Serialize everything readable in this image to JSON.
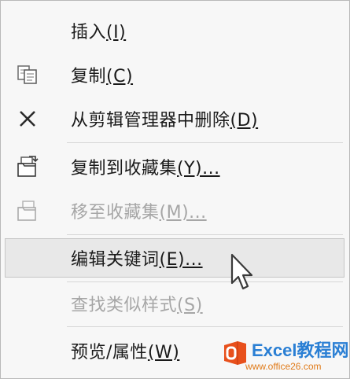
{
  "menu": {
    "items": [
      {
        "text": "插入",
        "accel": "(I)",
        "disabled": false,
        "icon": "none"
      },
      {
        "text": "复制",
        "accel": "(C)",
        "disabled": false,
        "icon": "copy-icon"
      },
      {
        "text": "从剪辑管理器中删除",
        "accel": "(D)",
        "disabled": false,
        "icon": "delete-x-icon"
      },
      {
        "text": "复制到收藏集",
        "accel": "(Y)...",
        "disabled": false,
        "icon": "copy-to-collection-icon"
      },
      {
        "text": "移至收藏集",
        "accel": "(M)...",
        "disabled": true,
        "icon": "move-to-collection-icon"
      },
      {
        "text": "编辑关键词",
        "accel": "(E)...",
        "disabled": false,
        "icon": "none"
      },
      {
        "text": "查找类似样式",
        "accel": "(S)",
        "disabled": true,
        "icon": "none"
      },
      {
        "text": "预览/属性",
        "accel": "(W)",
        "disabled": false,
        "icon": "none"
      }
    ],
    "hovered_item": "编辑关键词"
  },
  "watermark": {
    "title": "Excel教程网",
    "url": "www.office26.com"
  },
  "colors": {
    "menu_bg": "#f7f7f7",
    "hover_bg": "#e8e8e8",
    "disabled_text": "#a6a6a6",
    "watermark_blue": "#2a7fd4",
    "watermark_orange": "#e07b1a"
  }
}
